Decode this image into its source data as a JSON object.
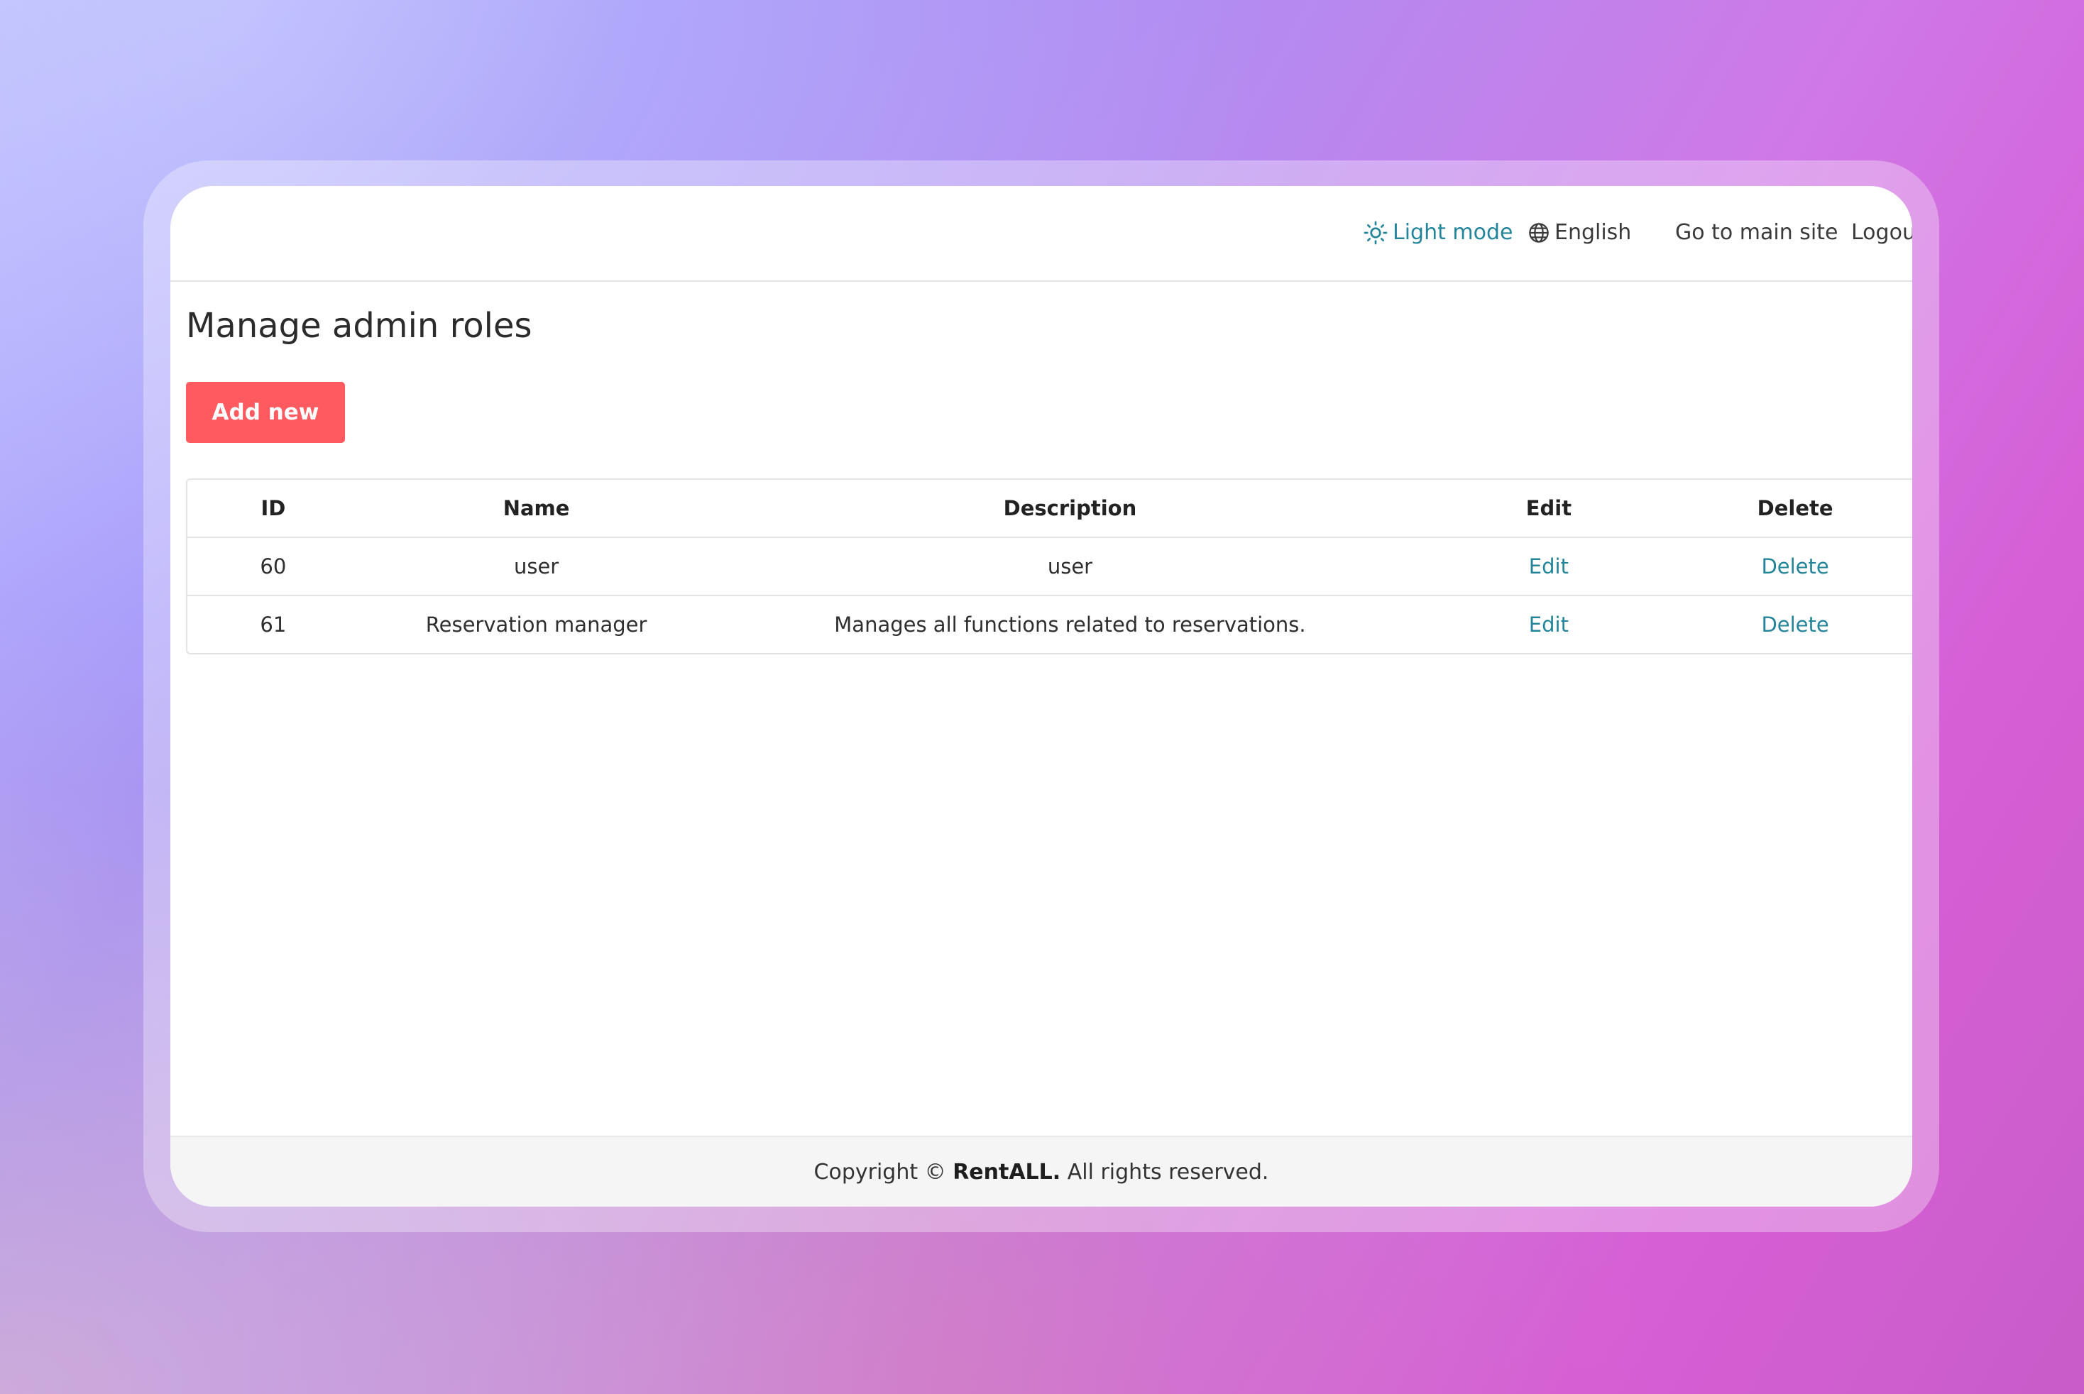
{
  "header": {
    "theme_label": "Light mode",
    "language_label": "English",
    "main_site_label": "Go to main site",
    "logout_label": "Logou"
  },
  "page": {
    "title": "Manage admin roles",
    "add_button_label": "Add new"
  },
  "table": {
    "columns": [
      "ID",
      "Name",
      "Description",
      "Edit",
      "Delete"
    ],
    "rows": [
      {
        "id": "60",
        "name": "user",
        "description": "user",
        "edit": "Edit",
        "delete": "Delete"
      },
      {
        "id": "61",
        "name": "Reservation manager",
        "description": "Manages all functions related to reservations.",
        "edit": "Edit",
        "delete": "Delete"
      }
    ]
  },
  "footer": {
    "prefix": "Copyright ©",
    "brand": "RentALL.",
    "suffix": "All rights reserved."
  },
  "colors": {
    "accent_link": "#24849a",
    "primary_button": "#ff5a5f"
  },
  "icons": {
    "theme": "sun-icon",
    "language": "globe-icon"
  }
}
